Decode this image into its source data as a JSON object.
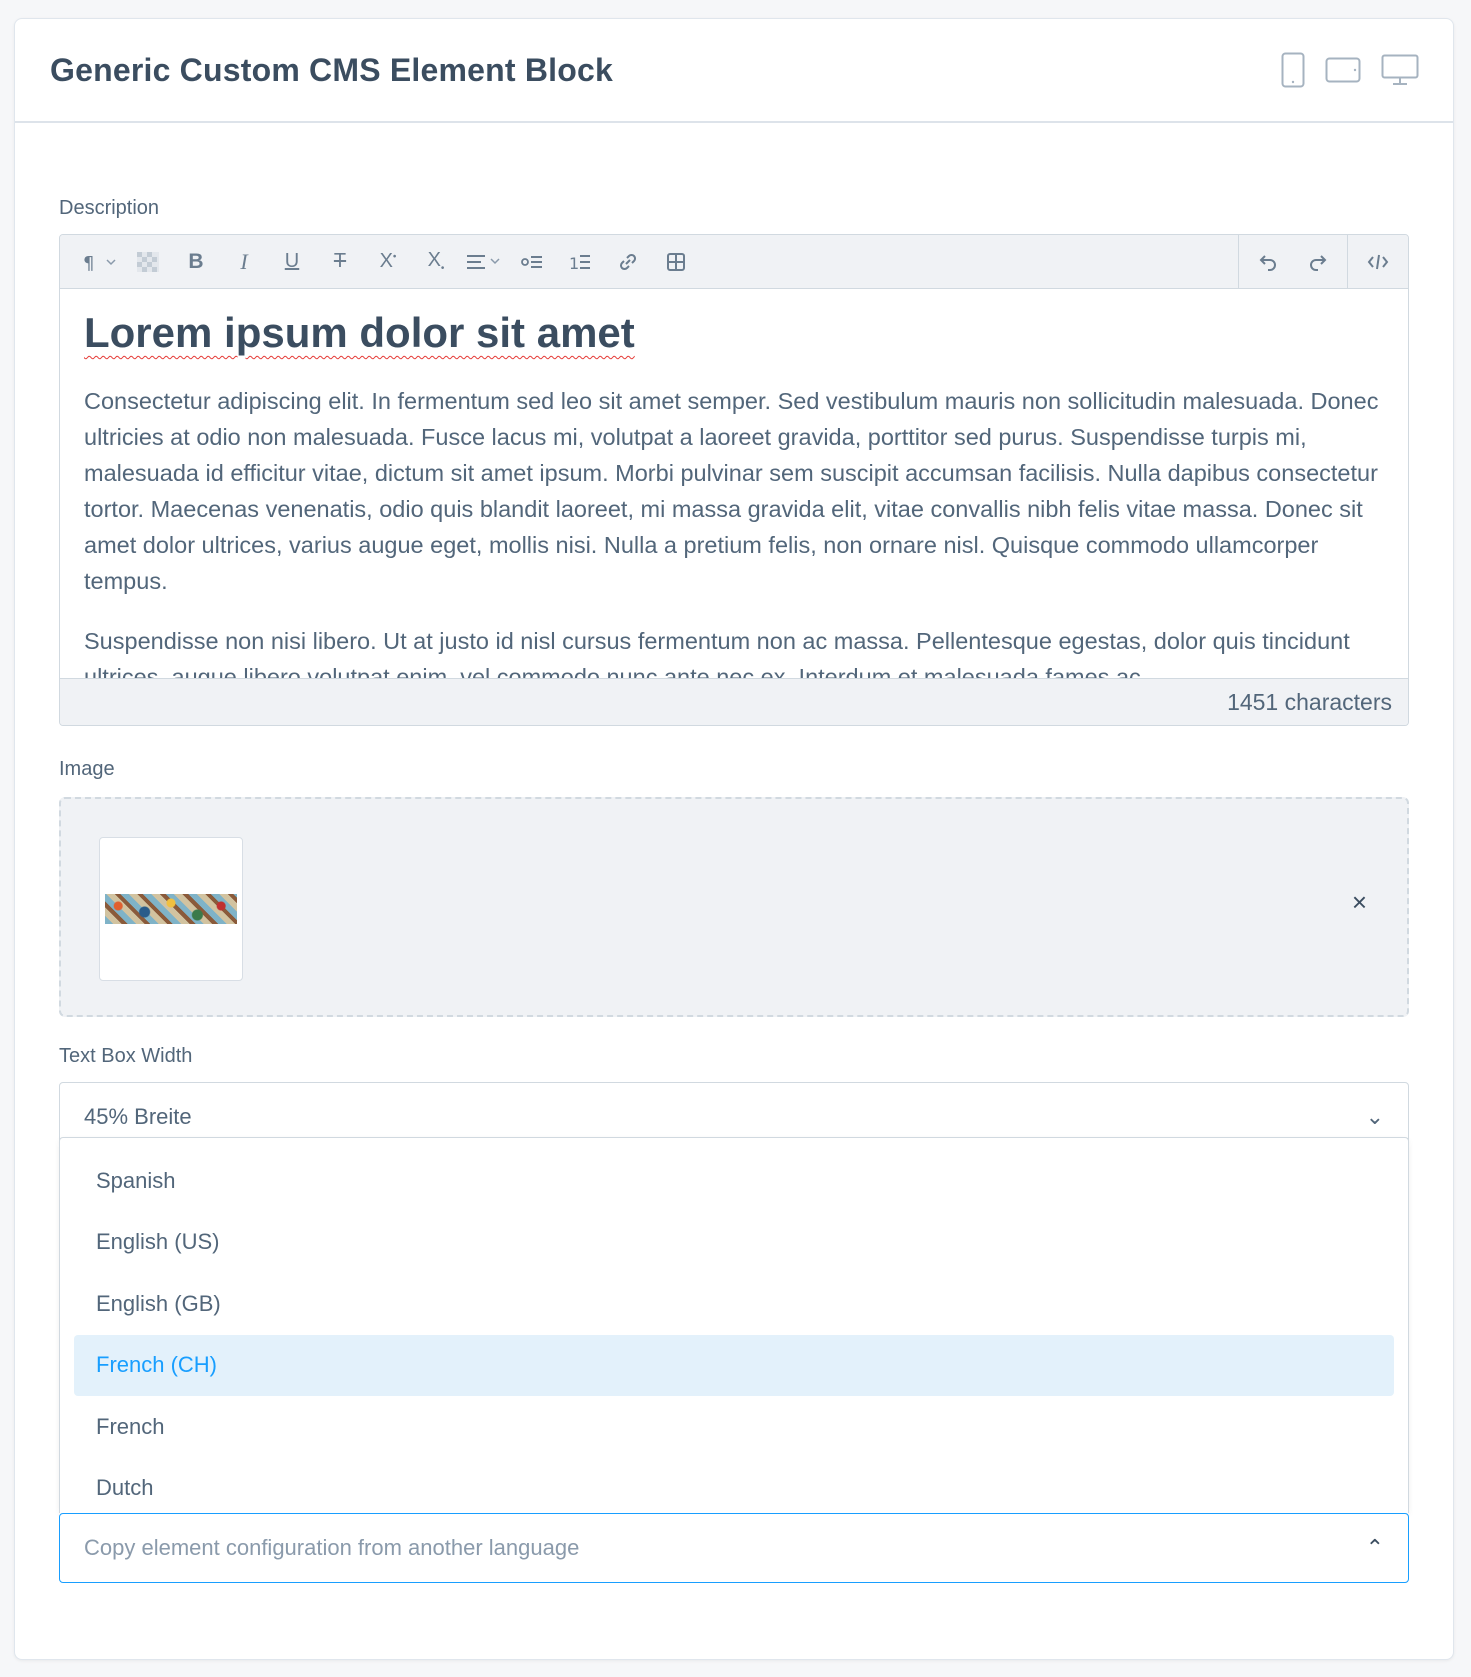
{
  "header": {
    "title": "Generic Custom CMS Element Block"
  },
  "description": {
    "label": "Description",
    "heading": "Lorem ipsum dolor sit amet",
    "paragraphs": [
      "Consectetur adipiscing elit. In fermentum sed leo sit amet semper. Sed vestibulum mauris non sollicitudin malesuada. Donec ultricies at odio non malesuada. Fusce lacus mi, volutpat a laoreet gravida, porttitor sed purus. Suspendisse turpis mi, malesuada id efficitur vitae, dictum sit amet ipsum. Morbi pulvinar sem suscipit accumsan facilisis. Nulla dapibus consectetur tortor. Maecenas venenatis, odio quis blandit laoreet, mi massa gravida elit, vitae convallis nibh felis vitae massa. Donec sit amet dolor ultrices, varius augue eget, mollis nisi. Nulla a pretium felis, non ornare nisl. Quisque commodo ullamcorper tempus.",
      "Suspendisse non nisi libero. Ut at justo id nisl cursus fermentum non ac massa. Pellentesque egestas, dolor quis tincidunt ultrices, augue libero volutpat enim, vel commodo nunc ante nec ex. Interdum et malesuada fames ac"
    ],
    "char_count": "1451 characters"
  },
  "image": {
    "label": "Image",
    "remove_glyph": "×"
  },
  "text_box_width": {
    "label": "Text Box Width",
    "value": "45% Breite",
    "chevron_glyph": "⌄"
  },
  "language_dropdown": {
    "options": [
      "Spanish",
      "English (US)",
      "English (GB)",
      "French (CH)",
      "French",
      "Dutch"
    ],
    "highlighted_index": 3
  },
  "copy_config": {
    "placeholder": "Copy element configuration from another language",
    "chevron_glyph": "⌃"
  },
  "colors": {
    "accent": "#189eff",
    "text": "#52667a",
    "heading": "#3b4d60"
  }
}
